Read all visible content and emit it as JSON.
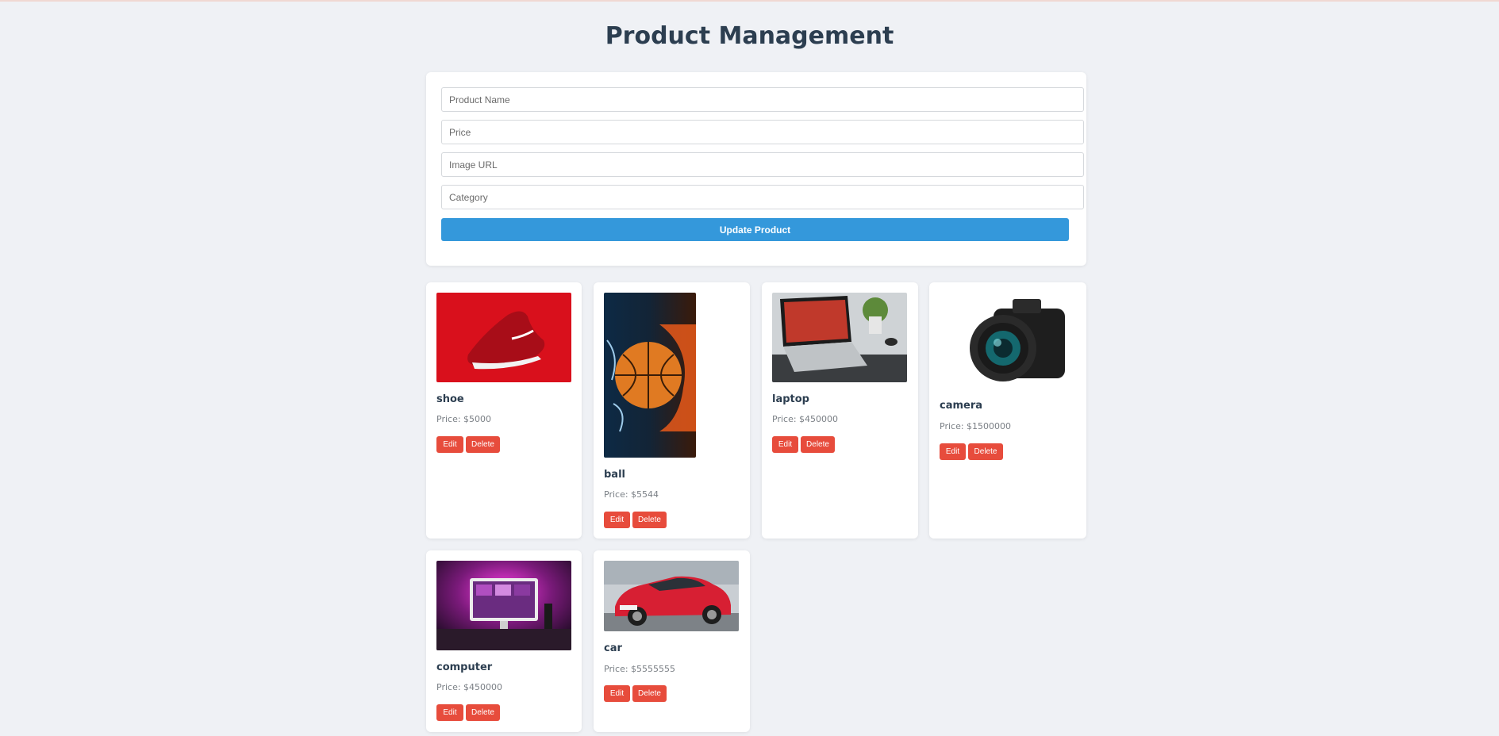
{
  "page": {
    "title": "Product Management"
  },
  "form": {
    "product_name_placeholder": "Product Name",
    "price_placeholder": "Price",
    "image_url_placeholder": "Image URL",
    "category_placeholder": "Category",
    "submit_label": "Update Product"
  },
  "products": [
    {
      "name": "shoe",
      "price": "Price: $5000",
      "image": "red-sneaker-image"
    },
    {
      "name": "ball",
      "price": "Price: $5544",
      "image": "basketball-fire-image"
    },
    {
      "name": "laptop",
      "price": "Price: $450000",
      "image": "laptop-desk-image"
    },
    {
      "name": "camera",
      "price": "Price: $1500000",
      "image": "dslr-camera-image"
    },
    {
      "name": "computer",
      "price": "Price: $450000",
      "image": "computer-setup-image"
    },
    {
      "name": "car",
      "price": "Price: $5555555",
      "image": "red-car-image"
    }
  ],
  "buttons": {
    "edit_label": "Edit",
    "delete_label": "Delete"
  },
  "colors": {
    "primary": "#3498db",
    "danger": "#e74c3c",
    "heading": "#2c3e50",
    "background": "#eff1f5"
  }
}
